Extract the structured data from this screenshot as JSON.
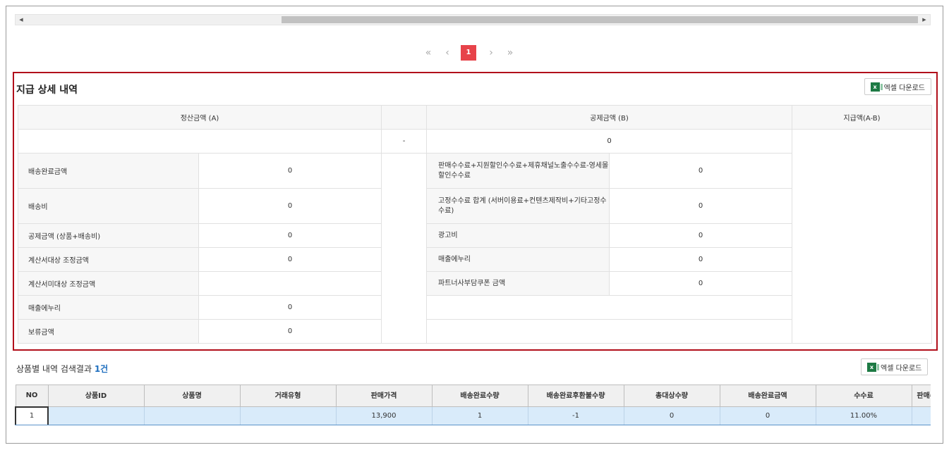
{
  "pagination": {
    "first": "«",
    "prev": "‹",
    "current": "1",
    "next": "›",
    "last": "»"
  },
  "detail": {
    "title": "지급 상세 내역",
    "excel_button": "엑셀 다운로드",
    "headers": {
      "settlement": "정산금액 (A)",
      "deduction": "공제금액 (B)",
      "payment": "지급액(A-B)"
    },
    "summary": {
      "settlement_total": "",
      "separator": "-",
      "deduction_total": "0",
      "payment_total": ""
    },
    "left_rows": [
      {
        "label": "배송완료금액",
        "value": "0"
      },
      {
        "label": "배송비",
        "value": "0"
      },
      {
        "label": "공제금액 (상품+배송비)",
        "value": "0"
      },
      {
        "label": "계산서대상 조정금액",
        "value": "0"
      },
      {
        "label": "계산서미대상 조정금액",
        "value": ""
      },
      {
        "label": "매출에누리",
        "value": "0"
      },
      {
        "label": "보류금액",
        "value": "0"
      }
    ],
    "right_rows": [
      {
        "label": "판매수수료+지원할인수수료+제휴채널노출수수료-영세몰할인수수료",
        "value": "0"
      },
      {
        "label": "고정수수료 합계 (서버이용료+컨텐츠제작비+기타고정수수료)",
        "value": "0"
      },
      {
        "label": "광고비",
        "value": "0"
      },
      {
        "label": "매출에누리",
        "value": "0"
      },
      {
        "label": "파트너사부담쿠폰 금액",
        "value": "0"
      }
    ]
  },
  "list": {
    "caption": "상품별 내역 검색결과",
    "count": "1건",
    "excel_button": "엑셀 다운로드",
    "columns": [
      "NO",
      "상품ID",
      "상품명",
      "거래유형",
      "판매가격",
      "배송완료수량",
      "배송완료후환불수량",
      "총대상수량",
      "배송완료금액",
      "수수료",
      "판매수료+"
    ],
    "row": [
      "1",
      "",
      "",
      "",
      "13,900",
      "1",
      "-1",
      "0",
      "0",
      "11.00%",
      ""
    ]
  },
  "icons": {
    "excel": "excel-icon",
    "scroll_left": "scroll-left-arrow-icon",
    "scroll_right": "scroll-right-arrow-icon"
  },
  "colors": {
    "accent_red": "#e7434a",
    "highlight_border": "#b10f1b",
    "selected_row": "#d9ebfa",
    "count_blue": "#1f6fbf"
  }
}
